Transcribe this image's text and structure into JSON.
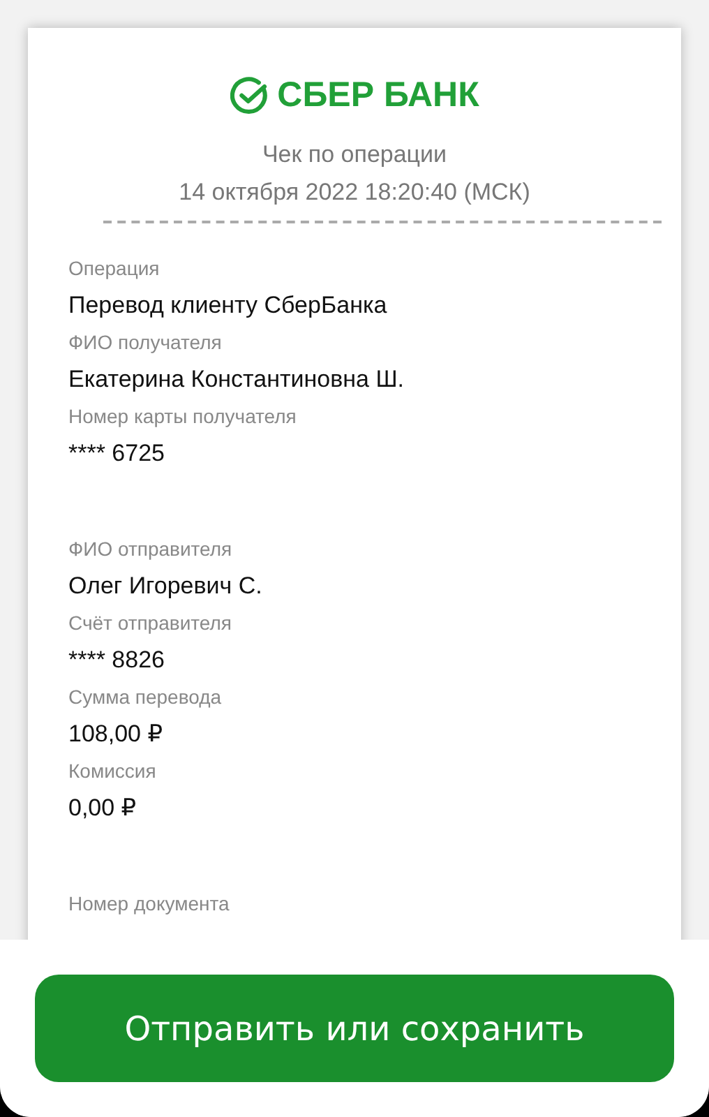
{
  "logo": {
    "text": "СБЕР БАНК"
  },
  "receipt": {
    "title": "Чек по операции",
    "datetime": "14 октября 2022 18:20:40 (МСК)",
    "sections": [
      {
        "fields": [
          {
            "label": "Операция",
            "value": "Перевод клиенту СберБанка"
          },
          {
            "label": "ФИО получателя",
            "value": "Екатерина Константиновна Ш."
          },
          {
            "label": "Номер карты получателя",
            "value": "**** 6725"
          }
        ]
      },
      {
        "fields": [
          {
            "label": "ФИО отправителя",
            "value": "Олег Игоревич С."
          },
          {
            "label": "Счёт отправителя",
            "value": "**** 8826"
          },
          {
            "label": "Сумма перевода",
            "value": "108,00 ₽"
          },
          {
            "label": "Комиссия",
            "value": "0,00 ₽"
          }
        ]
      },
      {
        "fields": [
          {
            "label": "Номер документа"
          }
        ]
      }
    ]
  },
  "action_button": {
    "label": "Отправить или сохранить"
  }
}
